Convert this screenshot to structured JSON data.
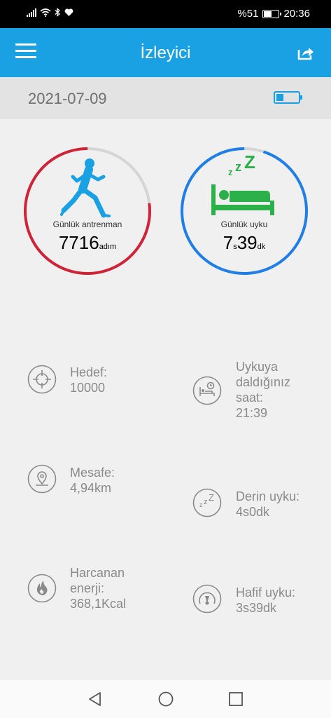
{
  "status_bar": {
    "battery_percent_text": "%51",
    "battery_level": 0.51,
    "time": "20:36",
    "icons": [
      "signal-icon",
      "wifi-icon",
      "bluetooth-icon",
      "heart-icon"
    ]
  },
  "app_bar": {
    "title": "İzleyici",
    "menu_icon": "hamburger-menu-icon",
    "share_icon": "share-icon"
  },
  "date_bar": {
    "date": "2021-07-09",
    "device_battery_icon": "battery-icon",
    "device_battery_level": 0.3
  },
  "rings": {
    "activity": {
      "label": "Günlük antrenman",
      "value": "7716",
      "unit": "adım",
      "progress": 0.77,
      "color": "#cf2338",
      "icon": "runner-icon"
    },
    "sleep": {
      "label": "Günlük uyku",
      "hours": "7",
      "hours_unit": "s",
      "minutes": "39",
      "minutes_unit": "dk",
      "progress": 0.95,
      "color": "#1f7fe6",
      "icon": "sleep-bed-icon"
    }
  },
  "stats": {
    "target": {
      "lines": [
        "Hedef:",
        "10000"
      ],
      "icon": "target-icon"
    },
    "distance": {
      "lines": [
        "Mesafe:",
        "4,94km"
      ],
      "icon": "location-pin-icon"
    },
    "energy": {
      "lines": [
        "Harcanan",
        "enerji:",
        "368,1Kcal"
      ],
      "icon": "flame-icon"
    },
    "sleep_time": {
      "lines": [
        "Uykuya",
        "daldığınız",
        "saat:",
        "21:39"
      ],
      "icon": "bed-clock-icon"
    },
    "deep_sleep": {
      "lines": [
        "Derin uyku:",
        "4s0dk"
      ],
      "icon": "zzz-icon"
    },
    "light_sleep": {
      "lines": [
        "Hafif uyku:",
        "3s39dk"
      ],
      "icon": "gauge-icon"
    }
  },
  "nav_bar": {
    "back_icon": "back-triangle-icon",
    "home_icon": "home-circle-icon",
    "recents_icon": "recents-square-icon"
  }
}
